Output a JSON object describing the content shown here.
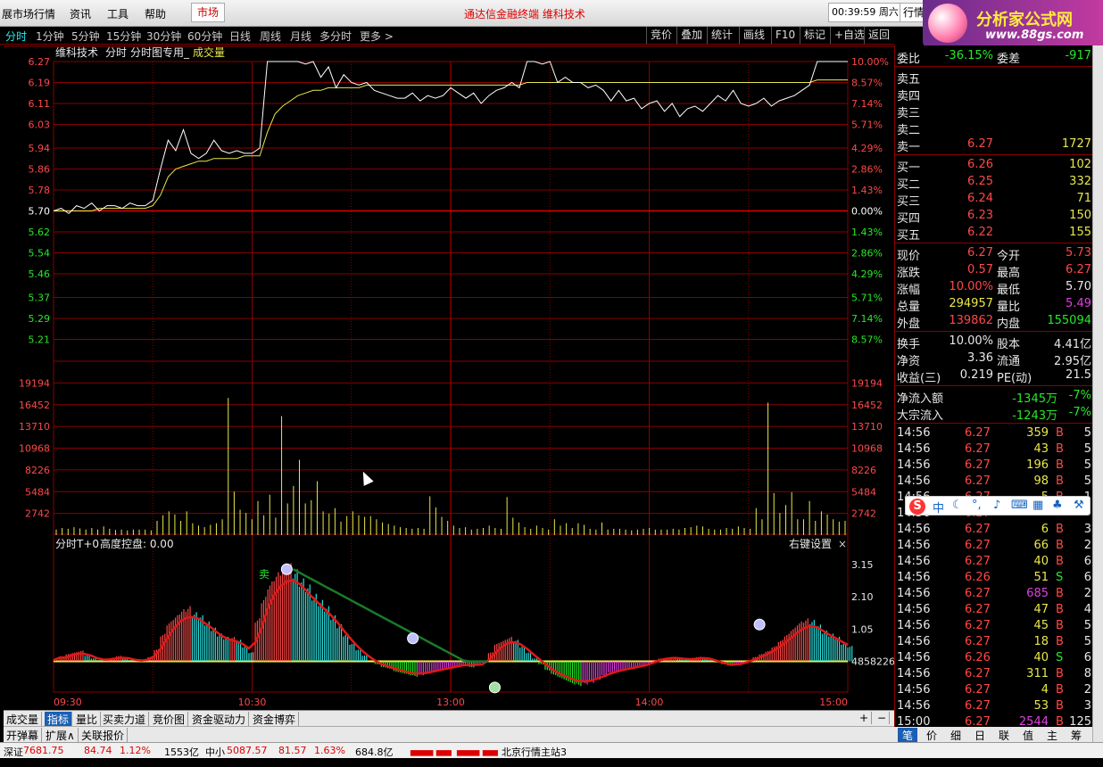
{
  "menubar": {
    "items": [
      "展市场行情",
      "资讯",
      "工具",
      "帮助"
    ],
    "market_button": "市场",
    "center_text": "通达信金融终端  维科技术",
    "clock": "00:39:59 周六",
    "hq_button": "行情"
  },
  "logo": {
    "title": "分析家公式网",
    "url_text": "www.88gs.com"
  },
  "periods": {
    "items": [
      "分时",
      "1分钟",
      "5分钟",
      "15分钟",
      "30分钟",
      "60分钟",
      "日线",
      "周线",
      "月线",
      "多分时",
      "更多 >"
    ],
    "active": "分时"
  },
  "toolbar": [
    "竞价",
    "叠加",
    "统计",
    "画线",
    "F10",
    "标记",
    "+自选",
    "返回"
  ],
  "chart_header": {
    "stock": "维科技术",
    "mode": "分时",
    "indicator": "分时图专用_",
    "vol_label": "成交量"
  },
  "indicator_header": {
    "name": "分时T+0",
    "label": "高度控盘: 0.00",
    "right_button": "右键设置",
    "close": "×"
  },
  "signal_label": "卖",
  "colors": {
    "up": "#ff4848",
    "down": "#27e827",
    "price_line": "#ffffff",
    "avg_line": "#e8e84a",
    "grid": "#8a0000",
    "cyan": "#2ee0e0",
    "magenta": "#e040e0"
  },
  "chart_data": [
    {
      "type": "line",
      "series": [
        {
          "values": [
            5.7,
            5.71,
            5.69,
            5.72,
            5.71,
            5.73,
            5.7,
            5.72,
            5.72,
            5.71,
            5.73,
            5.72,
            5.72,
            5.74,
            5.86,
            5.97,
            5.93,
            6.01,
            5.92,
            5.9,
            5.92,
            5.97,
            5.93,
            5.92,
            5.93,
            5.92,
            5.92,
            5.94,
            6.27,
            6.27,
            6.27,
            6.27,
            6.27,
            6.26,
            6.27,
            6.21,
            6.25,
            6.17,
            6.22,
            6.19,
            6.18,
            6.19,
            6.16,
            6.15,
            6.14,
            6.13,
            6.13,
            6.15,
            6.12,
            6.14,
            6.13,
            6.14,
            6.17,
            6.15,
            6.13,
            6.15,
            6.11,
            6.14,
            6.16,
            6.17,
            6.19,
            6.17,
            6.27,
            6.27,
            6.26,
            6.27,
            6.19,
            6.21,
            6.19,
            6.19,
            6.17,
            6.18,
            6.16,
            6.12,
            6.16,
            6.12,
            6.13,
            6.09,
            6.11,
            6.12,
            6.08,
            6.11,
            6.06,
            6.09,
            6.1,
            6.08,
            6.11,
            6.14,
            6.12,
            6.16,
            6.11,
            6.1,
            6.11,
            6.13,
            6.1,
            6.12,
            6.13,
            6.14,
            6.16,
            6.18,
            6.27,
            6.27,
            6.27,
            6.27,
            6.27
          ]
        },
        {
          "values": [
            5.7,
            5.7,
            5.7,
            5.7,
            5.7,
            5.7,
            5.71,
            5.71,
            5.71,
            5.71,
            5.71,
            5.71,
            5.71,
            5.72,
            5.76,
            5.83,
            5.86,
            5.87,
            5.88,
            5.89,
            5.89,
            5.9,
            5.9,
            5.9,
            5.9,
            5.91,
            5.91,
            5.91,
            6.0,
            6.07,
            6.1,
            6.12,
            6.14,
            6.15,
            6.16,
            6.16,
            6.17,
            6.17,
            6.17,
            6.17,
            6.17,
            6.18,
            6.18,
            6.18,
            6.18,
            6.18,
            6.18,
            6.18,
            6.18,
            6.18,
            6.18,
            6.18,
            6.18,
            6.18,
            6.18,
            6.18,
            6.18,
            6.18,
            6.18,
            6.18,
            6.18,
            6.18,
            6.19,
            6.19,
            6.19,
            6.19,
            6.19,
            6.19,
            6.19,
            6.19,
            6.19,
            6.19,
            6.19,
            6.19,
            6.19,
            6.19,
            6.19,
            6.19,
            6.19,
            6.19,
            6.19,
            6.19,
            6.19,
            6.19,
            6.19,
            6.19,
            6.19,
            6.19,
            6.19,
            6.19,
            6.19,
            6.19,
            6.19,
            6.19,
            6.19,
            6.19,
            6.19,
            6.19,
            6.19,
            6.19,
            6.2,
            6.2,
            6.2,
            6.2,
            6.2
          ]
        }
      ],
      "ylim": [
        5.13,
        6.27
      ],
      "left_ticks": [
        "6.27",
        "6.19",
        "6.11",
        "6.03",
        "5.94",
        "5.86",
        "5.78",
        "5.70",
        "5.62",
        "5.54",
        "5.46",
        "5.37",
        "5.29",
        "5.21"
      ],
      "right_ticks": [
        "10.00%",
        "8.57%",
        "7.14%",
        "5.71%",
        "4.29%",
        "2.86%",
        "1.43%",
        "0.00%",
        "1.43%",
        "2.86%",
        "4.29%",
        "5.71%",
        "7.14%",
        "8.57%"
      ],
      "x_ticks": [
        "09:30",
        "10:30",
        "13:00",
        "14:00",
        "15:00"
      ]
    },
    {
      "type": "bar",
      "values": [
        700,
        900,
        800,
        1000,
        850,
        700,
        900,
        700,
        1100,
        800,
        650,
        700,
        600,
        700,
        700,
        700,
        600,
        1800,
        2500,
        3000,
        2600,
        1800,
        3000,
        1500,
        1200,
        1000,
        1300,
        1500,
        2000,
        17300,
        5484,
        3200,
        2800,
        2000,
        4300,
        2500,
        5100,
        2200,
        15000,
        4000,
        6200,
        9500,
        4000,
        4400,
        6800,
        3000,
        2700,
        3400,
        1700,
        2400,
        3000,
        2500,
        2300,
        2400,
        2000,
        1600,
        1400,
        1200,
        1000,
        900,
        800,
        900,
        800,
        4900,
        3500,
        2300,
        1800,
        1200,
        900,
        1000,
        700,
        800,
        900,
        1200,
        900,
        800,
        4800,
        2200,
        1600,
        1000,
        800,
        1200,
        900,
        700,
        2000,
        1200,
        1500,
        900,
        1500,
        1300,
        800,
        700,
        1600,
        700,
        800,
        800,
        700,
        600,
        700,
        800,
        900,
        700,
        700,
        700,
        800,
        700,
        900,
        1000,
        1200,
        1100,
        800,
        700,
        700,
        900,
        800,
        1100,
        900,
        800,
        3400,
        2000,
        16700,
        5300,
        2800,
        3800,
        5400,
        2000,
        2000,
        4300,
        1800,
        3000,
        2600,
        2000,
        1700,
        1800
      ],
      "left_ticks": [
        "19194",
        "16452",
        "13710",
        "10968",
        "8226",
        "5484",
        "2742"
      ],
      "ylim": [
        0,
        21936
      ]
    },
    {
      "type": "bar",
      "values": [
        0.05,
        0.15,
        0.25,
        0.3,
        0.35,
        0.2,
        0.1,
        0.05,
        0.05,
        0.12,
        0.18,
        0.12,
        0.05,
        0.0,
        0.05,
        0.15,
        0.4,
        0.9,
        1.3,
        1.5,
        1.7,
        1.8,
        1.6,
        1.5,
        1.3,
        1.1,
        0.9,
        0.8,
        0.8,
        0.7,
        0.5,
        0.3,
        1.4,
        2.1,
        2.6,
        2.9,
        3.1,
        3.2,
        3.0,
        2.7,
        2.5,
        2.2,
        2.0,
        1.8,
        1.5,
        1.2,
        0.9,
        0.6,
        0.4,
        0.2,
        0.0,
        -0.1,
        -0.2,
        -0.25,
        -0.35,
        -0.4,
        -0.45,
        -0.5,
        -0.45,
        -0.4,
        -0.35,
        -0.3,
        -0.25,
        -0.2,
        -0.15,
        -0.1,
        -0.2,
        -0.1,
        -0.05,
        0.3,
        0.6,
        0.7,
        0.8,
        0.7,
        0.5,
        0.3,
        0.1,
        -0.1,
        -0.3,
        -0.45,
        -0.55,
        -0.65,
        -0.75,
        -0.8,
        -0.75,
        -0.7,
        -0.6,
        -0.5,
        -0.4,
        -0.35,
        -0.3,
        -0.25,
        -0.2,
        -0.15,
        -0.1,
        0.05,
        0.1,
        0.12,
        0.15,
        0.1,
        0.05,
        0.1,
        0.15,
        0.12,
        0.05,
        -0.05,
        -0.1,
        -0.15,
        -0.1,
        -0.05,
        0.05,
        0.15,
        0.25,
        0.35,
        0.5,
        0.7,
        0.9,
        1.1,
        1.3,
        1.4,
        1.35,
        1.2,
        1.0,
        0.9,
        0.8,
        0.6,
        0.5
      ],
      "right_ticks": [
        "3.15",
        "2.10",
        "1.05",
        "4858226"
      ],
      "ylim": [
        -1.0,
        3.5
      ]
    }
  ],
  "quote": {
    "weibi": {
      "label": "委比",
      "value": "-36.15%",
      "label2": "委差",
      "value2": "-917"
    },
    "asks": [
      {
        "label": "卖五",
        "price": "",
        "vol": ""
      },
      {
        "label": "卖四",
        "price": "",
        "vol": ""
      },
      {
        "label": "卖三",
        "price": "",
        "vol": ""
      },
      {
        "label": "卖二",
        "price": "",
        "vol": ""
      },
      {
        "label": "卖一",
        "price": "6.27",
        "vol": "1727"
      }
    ],
    "bids": [
      {
        "label": "买一",
        "price": "6.26",
        "vol": "102"
      },
      {
        "label": "买二",
        "price": "6.25",
        "vol": "332"
      },
      {
        "label": "买三",
        "price": "6.24",
        "vol": "71"
      },
      {
        "label": "买四",
        "price": "6.23",
        "vol": "150"
      },
      {
        "label": "买五",
        "price": "6.22",
        "vol": "155"
      }
    ],
    "stats": [
      {
        "l1": "现价",
        "v1": "6.27",
        "l2": "今开",
        "v2": "5.73"
      },
      {
        "l1": "涨跌",
        "v1": "0.57",
        "l2": "最高",
        "v2": "6.27"
      },
      {
        "l1": "涨幅",
        "v1": "10.00%",
        "l2": "最低",
        "v2": "5.70"
      },
      {
        "l1": "总量",
        "v1": "294957",
        "l2": "量比",
        "v2": "5.49"
      },
      {
        "l1": "外盘",
        "v1": "139862",
        "l2": "内盘",
        "v2": "155094"
      }
    ],
    "fund": [
      {
        "l1": "换手",
        "v1": "10.00%",
        "l2": "股本",
        "v2": "4.41亿"
      },
      {
        "l1": "净资",
        "v1": "3.36",
        "l2": "流通",
        "v2": "2.95亿"
      },
      {
        "l1": "收益(三)",
        "v1": "0.219",
        "l2": "PE(动)",
        "v2": "21.5"
      }
    ],
    "flow": [
      {
        "label": "净流入额",
        "value": "-1345万",
        "pct": "-7%"
      },
      {
        "label": "大宗流入",
        "value": "-1243万",
        "pct": "-7%"
      }
    ],
    "ticks": [
      {
        "time": "14:56",
        "price": "6.27",
        "vol": "359",
        "bs": "B",
        "n": "5"
      },
      {
        "time": "14:56",
        "price": "6.27",
        "vol": "43",
        "bs": "B",
        "n": "5"
      },
      {
        "time": "14:56",
        "price": "6.27",
        "vol": "196",
        "bs": "B",
        "n": "5"
      },
      {
        "time": "14:56",
        "price": "6.27",
        "vol": "98",
        "bs": "B",
        "n": "5"
      },
      {
        "time": "14:56",
        "price": "6.27",
        "vol": "5",
        "bs": "B",
        "n": "1"
      },
      {
        "time": "14:56",
        "price": "6.27",
        "vol": "",
        "bs": "",
        "n": ""
      },
      {
        "time": "14:56",
        "price": "6.27",
        "vol": "6",
        "bs": "B",
        "n": "3"
      },
      {
        "time": "14:56",
        "price": "6.27",
        "vol": "66",
        "bs": "B",
        "n": "2"
      },
      {
        "time": "14:56",
        "price": "6.27",
        "vol": "40",
        "bs": "B",
        "n": "6"
      },
      {
        "time": "14:56",
        "price": "6.26",
        "vol": "51",
        "bs": "S",
        "n": "6"
      },
      {
        "time": "14:56",
        "price": "6.27",
        "vol": "685",
        "bs": "B",
        "n": "2"
      },
      {
        "time": "14:56",
        "price": "6.27",
        "vol": "47",
        "bs": "B",
        "n": "4"
      },
      {
        "time": "14:56",
        "price": "6.27",
        "vol": "45",
        "bs": "B",
        "n": "5"
      },
      {
        "time": "14:56",
        "price": "6.27",
        "vol": "18",
        "bs": "B",
        "n": "5"
      },
      {
        "time": "14:56",
        "price": "6.26",
        "vol": "40",
        "bs": "S",
        "n": "6"
      },
      {
        "time": "14:56",
        "price": "6.27",
        "vol": "311",
        "bs": "B",
        "n": "8"
      },
      {
        "time": "14:56",
        "price": "6.27",
        "vol": "4",
        "bs": "B",
        "n": "2"
      },
      {
        "time": "14:56",
        "price": "6.27",
        "vol": "53",
        "bs": "B",
        "n": "3"
      },
      {
        "time": "15:00",
        "price": "6.27",
        "vol": "2544",
        "bs": "B",
        "n": "125"
      }
    ]
  },
  "bottom_tabs": [
    "成交量",
    "指标",
    "量比",
    "买卖力道",
    "竞价图",
    "资金驱动力",
    "资金博弈"
  ],
  "bottom_tabs_active": "指标",
  "bottom_tabs_controls": [
    "+",
    "−"
  ],
  "bottom_tabs2": [
    "开弹幕",
    "扩展∧",
    "关联报价"
  ],
  "right_tabs": [
    "笔",
    "价",
    "细",
    "日",
    "联",
    "值",
    "主",
    "筹"
  ],
  "status": {
    "index1_name": "深证",
    "index1_value": "7681.75",
    "index1_change": "84.74",
    "index1_pct": "1.12%",
    "index1_amount": "1553亿",
    "index2_name": "中小",
    "index2_value": "5087.57",
    "index2_change": "81.57",
    "index2_pct": "1.63%",
    "index2_amount": "684.8亿",
    "server": "北京行情主站3"
  },
  "ime": {
    "logo": "S",
    "mode": "中"
  }
}
